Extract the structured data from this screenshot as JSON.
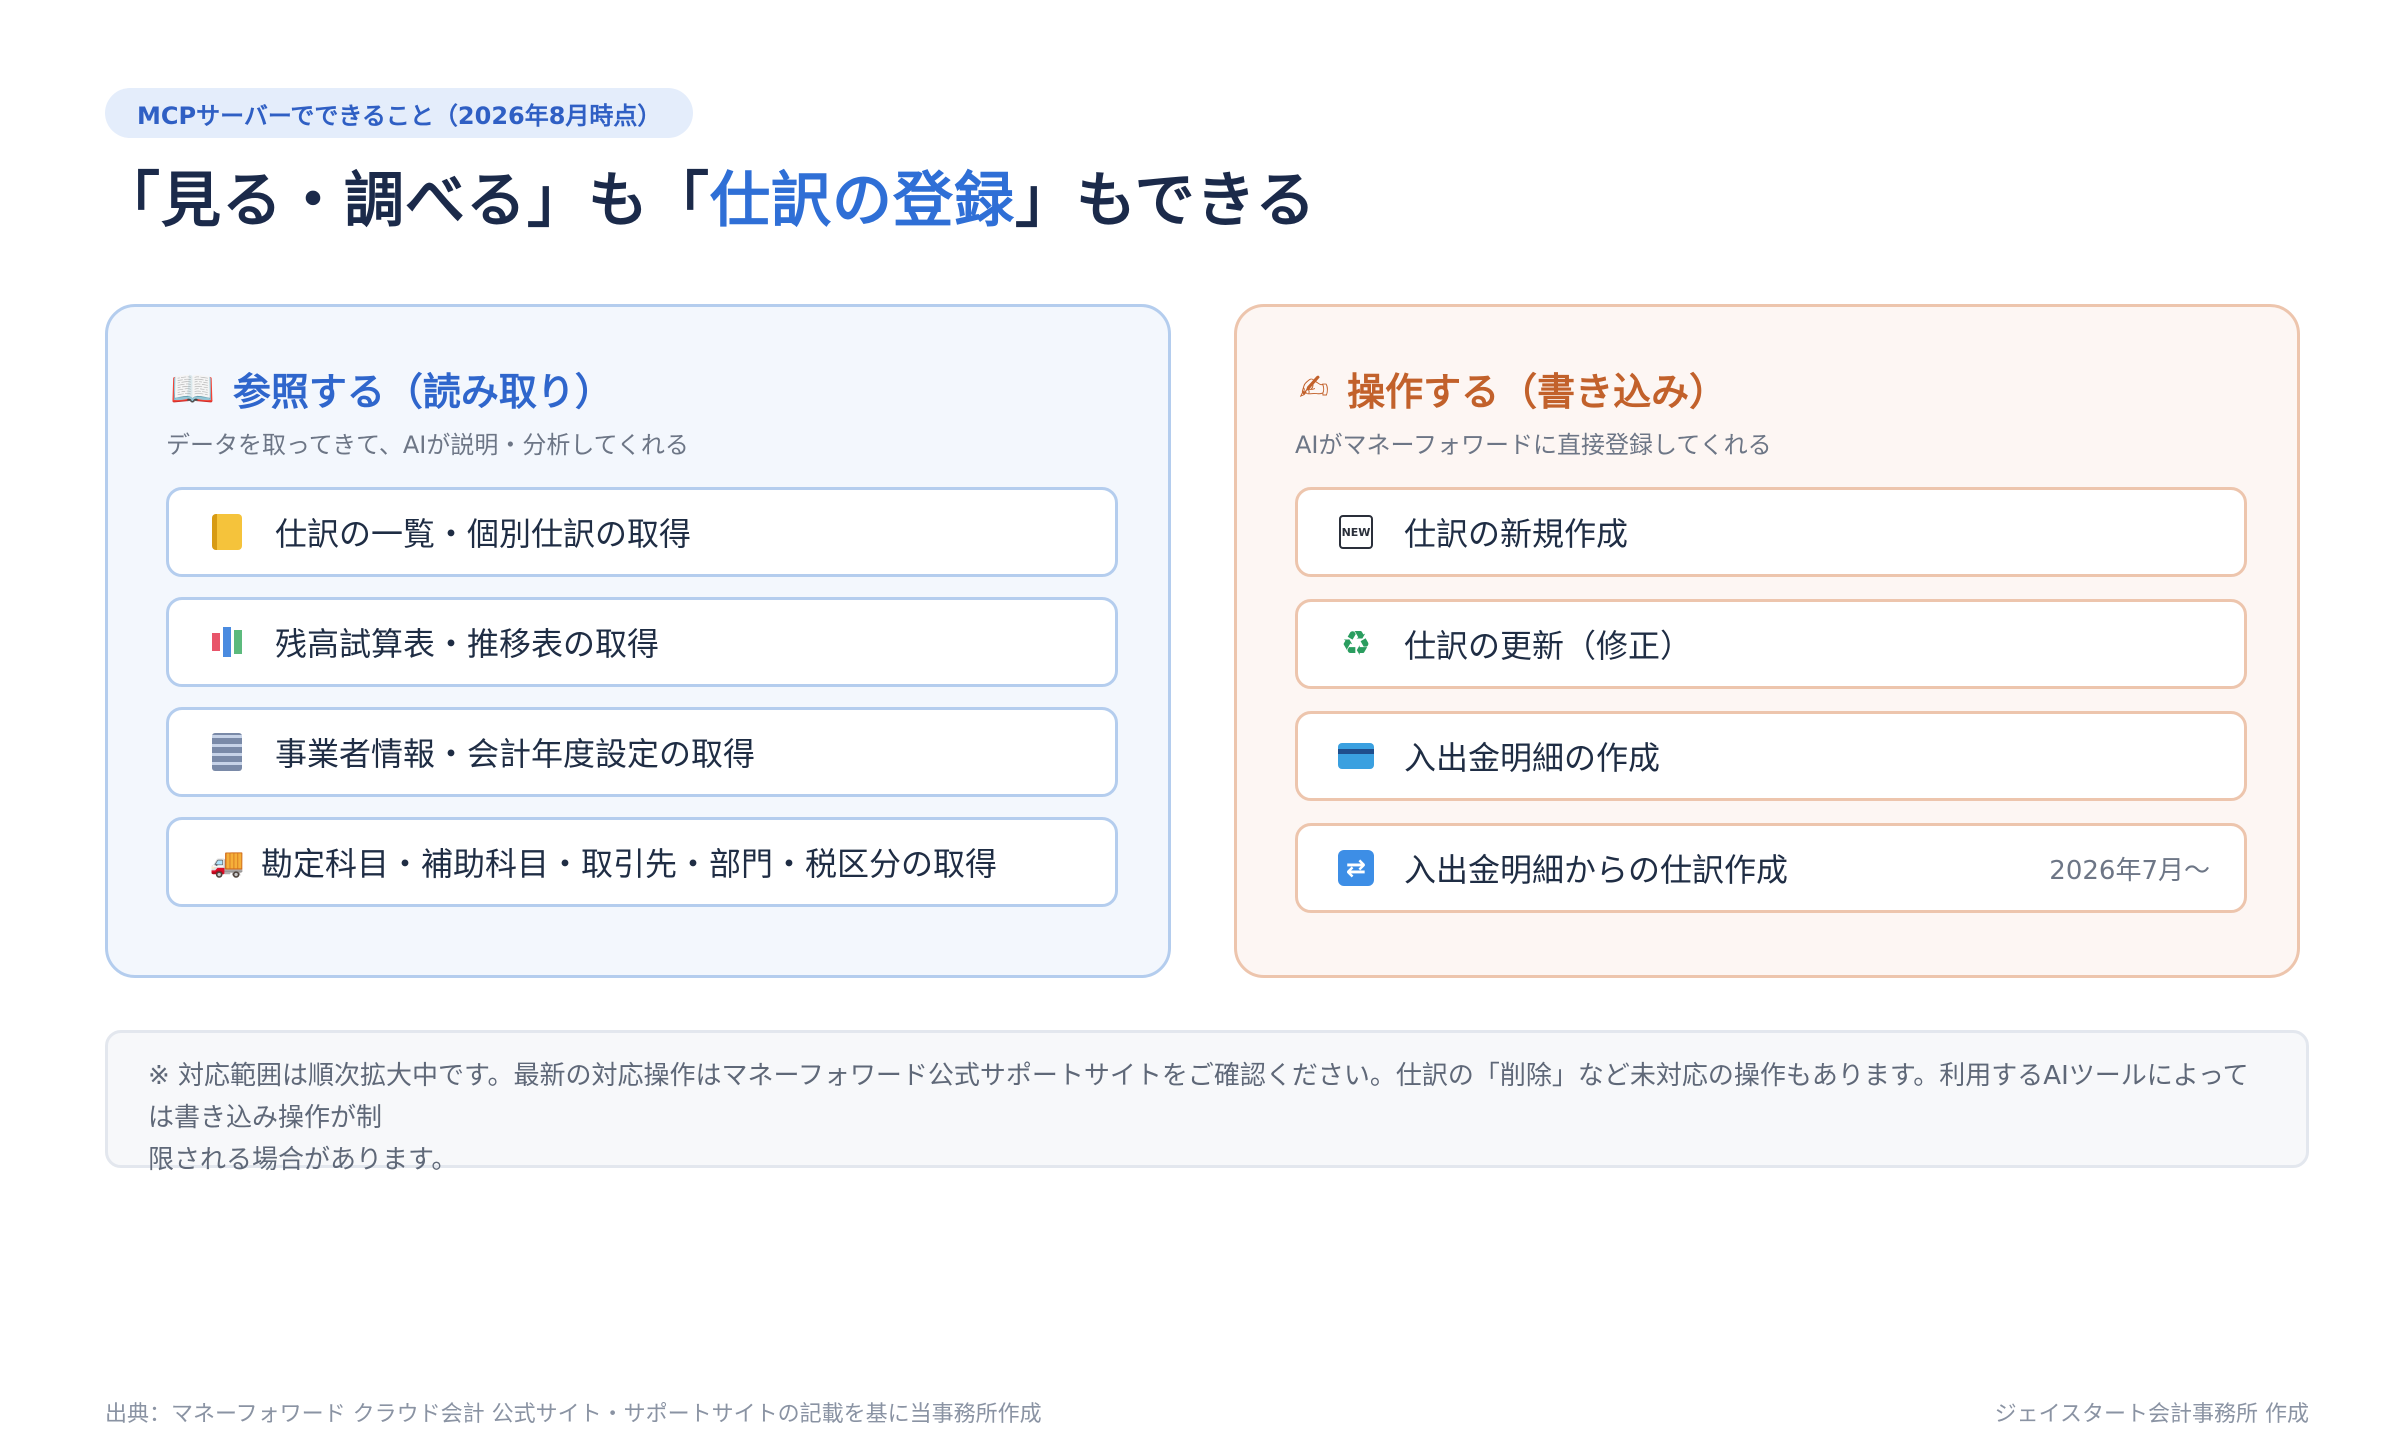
{
  "header": {
    "badge": "MCPサーバーでできること（2026年8月時点）",
    "title_part1": "「見る・調べる」も「",
    "title_highlight": "仕訳の登録",
    "title_part2": "」もできる"
  },
  "read_panel": {
    "icon": "open-book-icon",
    "title": "参照する（読み取り）",
    "subtitle": "データを取ってきて、AIが説明・分析してくれる",
    "items": [
      {
        "icon": "notebook-icon",
        "label": "仕訳の一覧・個別仕訳の取得"
      },
      {
        "icon": "bar-chart-icon",
        "label": "残高試算表・推移表の取得"
      },
      {
        "icon": "office-building-icon",
        "label": "事業者情報・会計年度設定の取得"
      },
      {
        "icon": "truck-icon",
        "label": "勘定科目・補助科目・取引先・部門・税区分の取得"
      }
    ]
  },
  "write_panel": {
    "icon": "writing-hand-icon",
    "title": "操作する（書き込み）",
    "subtitle": "AIがマネーフォワードに直接登録してくれる",
    "items": [
      {
        "icon": "new-icon",
        "label": "仕訳の新規作成",
        "note": ""
      },
      {
        "icon": "recycle-icon",
        "label": "仕訳の更新（修正）",
        "note": ""
      },
      {
        "icon": "credit-card-icon",
        "label": "入出金明細の作成",
        "note": ""
      },
      {
        "icon": "repeat-icon",
        "label": "入出金明細からの仕訳作成",
        "note": "2026年7月～"
      }
    ]
  },
  "notice": {
    "line1": "※ 対応範囲は順次拡大中です。最新の対応操作はマネーフォワード公式サポートサイトをご確認ください。仕訳の「削除」など未対応の操作もあります。利用するAIツールによっては書き込み操作が制",
    "line2": "限される場合があります。"
  },
  "footer": {
    "source": "出典：マネーフォワード クラウド会計 公式サイト・サポートサイトの記載を基に当事務所作成",
    "author": "ジェイスタート会計事務所 作成"
  },
  "colors": {
    "accent_blue": "#2f6fd6",
    "accent_orange": "#c2612b",
    "title_navy": "#1b2a4a"
  }
}
